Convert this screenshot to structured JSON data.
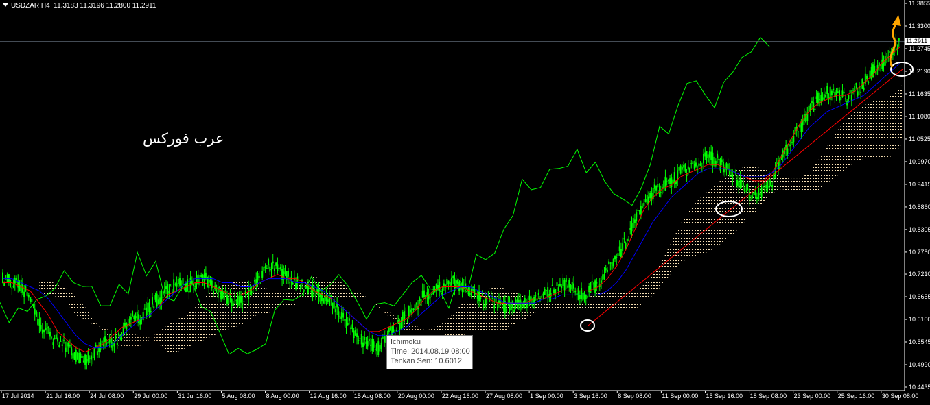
{
  "header": {
    "symbol_timeframe": "USDZAR,H4",
    "ohlc": "11.3183 11.3196 11.2800 11.2911"
  },
  "watermark_text": "عرب فوركس",
  "tooltip": {
    "title": "Ichimoku",
    "time": "Time: 2014.08.19 08:00",
    "value": "Tenkan Sen: 10.6012"
  },
  "colors": {
    "background": "#000000",
    "candles": "#00FF00",
    "tenkan": "#FF0000",
    "kijun": "#0000FF",
    "chikou": "#00FF00",
    "cloud_up": "#F5DEB3",
    "cloud_down": "#D2B48C",
    "trendline": "#FF0000",
    "price_line": "#C0C0C0",
    "arrow": "#FFA500",
    "circles": "#FFFFFF"
  },
  "chart_data": {
    "type": "candlestick",
    "title": "USDZAR,H4",
    "ylim": [
      10.4435,
      11.3855
    ],
    "y_ticks": [
      "11.3855",
      "11.3300",
      "11.2745",
      "11.2190",
      "11.1635",
      "11.1080",
      "11.0525",
      "10.9970",
      "10.9415",
      "10.8860",
      "10.8305",
      "10.7750",
      "10.7210",
      "10.6655",
      "10.6100",
      "10.5545",
      "10.4990",
      "10.4435"
    ],
    "x_ticks": [
      "17 Jul 2014",
      "21 Jul 16:00",
      "24 Jul 08:00",
      "29 Jul 00:00",
      "31 Jul 16:00",
      "5 Aug 08:00",
      "8 Aug 00:00",
      "12 Aug 16:00",
      "15 Aug 08:00",
      "20 Aug 00:00",
      "22 Aug 16:00",
      "27 Aug 08:00",
      "1 Sep 00:00",
      "3 Sep 16:00",
      "8 Sep 08:00",
      "11 Sep 00:00",
      "15 Sep 16:00",
      "18 Sep 08:00",
      "23 Sep 00:00",
      "25 Sep 16:00",
      "30 Sep 08:00"
    ],
    "current_price": "11.2911",
    "series": [
      {
        "name": "Close",
        "values": [
          10.71,
          10.7,
          10.69,
          10.66,
          10.6,
          10.58,
          10.55,
          10.54,
          10.52,
          10.51,
          10.53,
          10.56,
          10.55,
          10.58,
          10.62,
          10.61,
          10.64,
          10.66,
          10.68,
          10.7,
          10.69,
          10.7,
          10.71,
          10.69,
          10.67,
          10.66,
          10.65,
          10.68,
          10.71,
          10.74,
          10.73,
          10.72,
          10.7,
          10.69,
          10.68,
          10.66,
          10.65,
          10.62,
          10.59,
          10.56,
          10.55,
          10.54,
          10.57,
          10.59,
          10.62,
          10.64,
          10.67,
          10.68,
          10.69,
          10.7,
          10.69,
          10.68,
          10.66,
          10.65,
          10.65,
          10.64,
          10.64,
          10.65,
          10.66,
          10.67,
          10.68,
          10.7,
          10.69,
          10.67,
          10.68,
          10.7,
          10.73,
          10.76,
          10.8,
          10.85,
          10.9,
          10.92,
          10.94,
          10.95,
          10.97,
          10.98,
          10.99,
          11.01,
          11.0,
          10.98,
          10.96,
          10.93,
          10.91,
          10.92,
          10.95,
          11.0,
          11.05,
          11.08,
          11.12,
          11.15,
          11.17,
          11.16,
          11.15,
          11.17,
          11.19,
          11.22,
          11.24,
          11.27,
          11.29
        ]
      },
      {
        "name": "Tenkan Sen",
        "values": [
          10.7,
          10.7,
          10.69,
          10.68,
          10.65,
          10.62,
          10.58,
          10.56,
          10.54,
          10.53,
          10.54,
          10.55,
          10.57,
          10.59,
          10.6,
          10.61,
          10.62,
          10.64,
          10.67,
          10.68,
          10.69,
          10.7,
          10.7,
          10.69,
          10.68,
          10.67,
          10.67,
          10.68,
          10.7,
          10.71,
          10.72,
          10.71,
          10.71,
          10.7,
          10.68,
          10.67,
          10.66,
          10.64,
          10.62,
          10.6,
          10.58,
          10.58,
          10.59,
          10.6,
          10.61,
          10.63,
          10.66,
          10.68,
          10.69,
          10.69,
          10.69,
          10.68,
          10.67,
          10.66,
          10.65,
          10.65,
          10.65,
          10.65,
          10.66,
          10.66,
          10.67,
          10.68,
          10.68,
          10.68,
          10.68,
          10.69,
          10.71,
          10.74,
          10.78,
          10.83,
          10.88,
          10.91,
          10.93,
          10.94,
          10.96,
          10.97,
          10.98,
          10.99,
          10.99,
          10.98,
          10.97,
          10.96,
          10.95,
          10.95,
          10.97,
          11.01,
          11.05,
          11.09,
          11.12,
          11.14,
          11.15,
          11.16,
          11.16,
          11.17,
          11.19,
          11.21,
          11.24,
          11.26,
          11.28
        ]
      },
      {
        "name": "Kijun Sen",
        "values": [
          10.71,
          10.71,
          10.7,
          10.69,
          10.68,
          10.66,
          10.63,
          10.6,
          10.57,
          10.55,
          10.54,
          10.54,
          10.55,
          10.57,
          10.59,
          10.61,
          10.62,
          10.64,
          10.66,
          10.68,
          10.7,
          10.71,
          10.71,
          10.71,
          10.7,
          10.7,
          10.69,
          10.69,
          10.7,
          10.71,
          10.71,
          10.71,
          10.7,
          10.7,
          10.69,
          10.68,
          10.66,
          10.64,
          10.62,
          10.6,
          10.58,
          10.57,
          10.57,
          10.58,
          10.59,
          10.61,
          10.63,
          10.65,
          10.67,
          10.68,
          10.69,
          10.69,
          10.68,
          10.67,
          10.66,
          10.65,
          10.65,
          10.65,
          10.65,
          10.66,
          10.66,
          10.67,
          10.67,
          10.67,
          10.67,
          10.67,
          10.68,
          10.7,
          10.73,
          10.77,
          10.81,
          10.85,
          10.88,
          10.91,
          10.93,
          10.95,
          10.97,
          10.98,
          10.98,
          10.98,
          10.97,
          10.96,
          10.96,
          10.96,
          10.97,
          10.99,
          11.02,
          11.05,
          11.08,
          11.1,
          11.12,
          11.13,
          11.14,
          11.15,
          11.16,
          11.18,
          11.2,
          11.22,
          11.24
        ]
      }
    ]
  }
}
